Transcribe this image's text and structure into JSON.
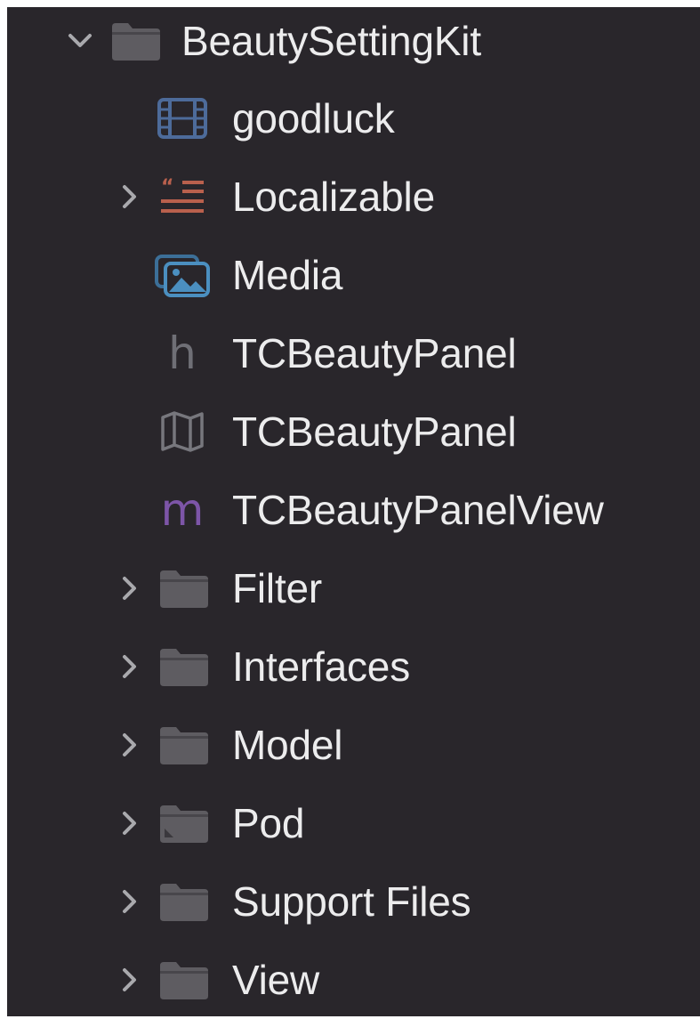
{
  "navigator": {
    "root": {
      "label": "BeautySettingKit",
      "icon": "folder-icon",
      "expanded": true
    },
    "files": [
      {
        "label": "goodluck",
        "icon": "video-file-icon",
        "icon_color": "#4d6b9a"
      },
      {
        "label": "Localizable",
        "icon": "strings-file-icon",
        "icon_color": "#b9604d",
        "expandable": true
      },
      {
        "label": "Media",
        "icon": "asset-catalog-icon",
        "icon_color": "#4b8fc0"
      },
      {
        "label": "TCBeautyPanel",
        "icon": "header-file-icon",
        "glyph": "h",
        "icon_color": "#6f6f76"
      },
      {
        "label": "TCBeautyPanel",
        "icon": "map-file-icon",
        "icon_color": "#77777d"
      },
      {
        "label": "TCBeautyPanelView",
        "icon": "objc-file-icon",
        "glyph": "m",
        "icon_color": "#7d55a8"
      }
    ],
    "folders": [
      {
        "label": "Filter",
        "icon": "folder-icon"
      },
      {
        "label": "Interfaces",
        "icon": "folder-icon"
      },
      {
        "label": "Model",
        "icon": "folder-icon"
      },
      {
        "label": "Pod",
        "icon": "pod-folder-icon"
      },
      {
        "label": "Support Files",
        "icon": "folder-icon"
      },
      {
        "label": "View",
        "icon": "folder-icon"
      }
    ]
  },
  "colors": {
    "background": "#29262b",
    "text": "#ececed",
    "chevron": "#a9a9ad",
    "folder": "#5e5c61"
  }
}
